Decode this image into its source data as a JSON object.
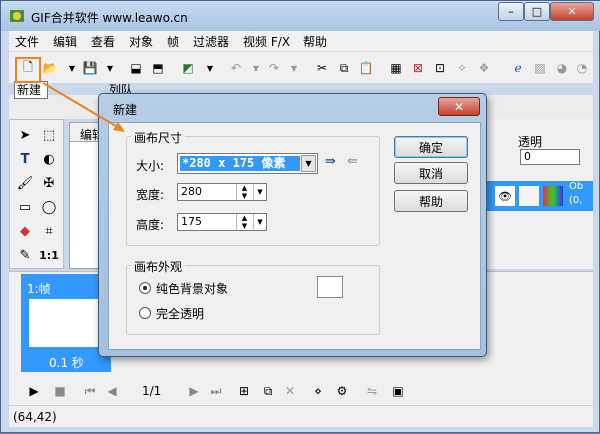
{
  "window": {
    "title": "GIF合并软件 www.leawo.cn"
  },
  "menu": [
    "文件",
    "编辑",
    "查看",
    "对象",
    "帧",
    "过滤器",
    "视频 F/X",
    "帮助"
  ],
  "tooltip": "新建",
  "bg": {
    "tab_label": "列队",
    "editor_tab": "编辑",
    "transparency_label": "透明",
    "transparency_value": "0",
    "layer_text_1": "Ob",
    "layer_text_2": "(0,",
    "frame_label": "1:帧",
    "frame_time": "0.1 秒",
    "page_indicator": "1/1",
    "status": "(64,42)"
  },
  "dialog": {
    "title": "新建",
    "canvas_size_group": "画布尺寸",
    "size_label": "大小:",
    "size_value": "*280 x 175 像素",
    "width_label": "宽度:",
    "width_value": "280",
    "height_label": "高度:",
    "height_value": "175",
    "appearance_group": "画布外观",
    "option_solid": "纯色背景对象",
    "option_transparent": "完全透明",
    "ok": "确定",
    "cancel": "取消",
    "help": "帮助"
  },
  "colors": {
    "highlight": "#f08020",
    "selection": "#3399ff"
  }
}
